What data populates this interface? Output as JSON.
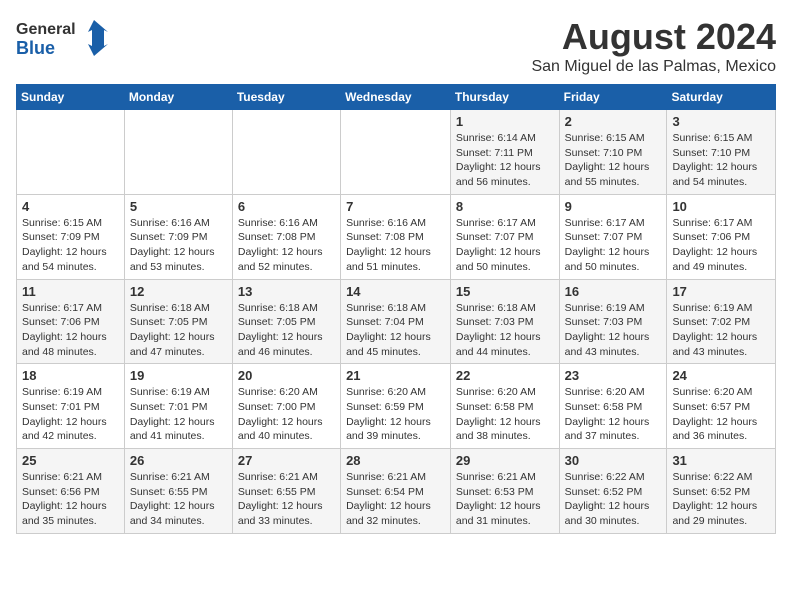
{
  "header": {
    "logo_general": "General",
    "logo_blue": "Blue",
    "month_year": "August 2024",
    "location": "San Miguel de las Palmas, Mexico"
  },
  "days_of_week": [
    "Sunday",
    "Monday",
    "Tuesday",
    "Wednesday",
    "Thursday",
    "Friday",
    "Saturday"
  ],
  "weeks": [
    [
      {
        "day": "",
        "info": ""
      },
      {
        "day": "",
        "info": ""
      },
      {
        "day": "",
        "info": ""
      },
      {
        "day": "",
        "info": ""
      },
      {
        "day": "1",
        "info": "Sunrise: 6:14 AM\nSunset: 7:11 PM\nDaylight: 12 hours\nand 56 minutes."
      },
      {
        "day": "2",
        "info": "Sunrise: 6:15 AM\nSunset: 7:10 PM\nDaylight: 12 hours\nand 55 minutes."
      },
      {
        "day": "3",
        "info": "Sunrise: 6:15 AM\nSunset: 7:10 PM\nDaylight: 12 hours\nand 54 minutes."
      }
    ],
    [
      {
        "day": "4",
        "info": "Sunrise: 6:15 AM\nSunset: 7:09 PM\nDaylight: 12 hours\nand 54 minutes."
      },
      {
        "day": "5",
        "info": "Sunrise: 6:16 AM\nSunset: 7:09 PM\nDaylight: 12 hours\nand 53 minutes."
      },
      {
        "day": "6",
        "info": "Sunrise: 6:16 AM\nSunset: 7:08 PM\nDaylight: 12 hours\nand 52 minutes."
      },
      {
        "day": "7",
        "info": "Sunrise: 6:16 AM\nSunset: 7:08 PM\nDaylight: 12 hours\nand 51 minutes."
      },
      {
        "day": "8",
        "info": "Sunrise: 6:17 AM\nSunset: 7:07 PM\nDaylight: 12 hours\nand 50 minutes."
      },
      {
        "day": "9",
        "info": "Sunrise: 6:17 AM\nSunset: 7:07 PM\nDaylight: 12 hours\nand 50 minutes."
      },
      {
        "day": "10",
        "info": "Sunrise: 6:17 AM\nSunset: 7:06 PM\nDaylight: 12 hours\nand 49 minutes."
      }
    ],
    [
      {
        "day": "11",
        "info": "Sunrise: 6:17 AM\nSunset: 7:06 PM\nDaylight: 12 hours\nand 48 minutes."
      },
      {
        "day": "12",
        "info": "Sunrise: 6:18 AM\nSunset: 7:05 PM\nDaylight: 12 hours\nand 47 minutes."
      },
      {
        "day": "13",
        "info": "Sunrise: 6:18 AM\nSunset: 7:05 PM\nDaylight: 12 hours\nand 46 minutes."
      },
      {
        "day": "14",
        "info": "Sunrise: 6:18 AM\nSunset: 7:04 PM\nDaylight: 12 hours\nand 45 minutes."
      },
      {
        "day": "15",
        "info": "Sunrise: 6:18 AM\nSunset: 7:03 PM\nDaylight: 12 hours\nand 44 minutes."
      },
      {
        "day": "16",
        "info": "Sunrise: 6:19 AM\nSunset: 7:03 PM\nDaylight: 12 hours\nand 43 minutes."
      },
      {
        "day": "17",
        "info": "Sunrise: 6:19 AM\nSunset: 7:02 PM\nDaylight: 12 hours\nand 43 minutes."
      }
    ],
    [
      {
        "day": "18",
        "info": "Sunrise: 6:19 AM\nSunset: 7:01 PM\nDaylight: 12 hours\nand 42 minutes."
      },
      {
        "day": "19",
        "info": "Sunrise: 6:19 AM\nSunset: 7:01 PM\nDaylight: 12 hours\nand 41 minutes."
      },
      {
        "day": "20",
        "info": "Sunrise: 6:20 AM\nSunset: 7:00 PM\nDaylight: 12 hours\nand 40 minutes."
      },
      {
        "day": "21",
        "info": "Sunrise: 6:20 AM\nSunset: 6:59 PM\nDaylight: 12 hours\nand 39 minutes."
      },
      {
        "day": "22",
        "info": "Sunrise: 6:20 AM\nSunset: 6:58 PM\nDaylight: 12 hours\nand 38 minutes."
      },
      {
        "day": "23",
        "info": "Sunrise: 6:20 AM\nSunset: 6:58 PM\nDaylight: 12 hours\nand 37 minutes."
      },
      {
        "day": "24",
        "info": "Sunrise: 6:20 AM\nSunset: 6:57 PM\nDaylight: 12 hours\nand 36 minutes."
      }
    ],
    [
      {
        "day": "25",
        "info": "Sunrise: 6:21 AM\nSunset: 6:56 PM\nDaylight: 12 hours\nand 35 minutes."
      },
      {
        "day": "26",
        "info": "Sunrise: 6:21 AM\nSunset: 6:55 PM\nDaylight: 12 hours\nand 34 minutes."
      },
      {
        "day": "27",
        "info": "Sunrise: 6:21 AM\nSunset: 6:55 PM\nDaylight: 12 hours\nand 33 minutes."
      },
      {
        "day": "28",
        "info": "Sunrise: 6:21 AM\nSunset: 6:54 PM\nDaylight: 12 hours\nand 32 minutes."
      },
      {
        "day": "29",
        "info": "Sunrise: 6:21 AM\nSunset: 6:53 PM\nDaylight: 12 hours\nand 31 minutes."
      },
      {
        "day": "30",
        "info": "Sunrise: 6:22 AM\nSunset: 6:52 PM\nDaylight: 12 hours\nand 30 minutes."
      },
      {
        "day": "31",
        "info": "Sunrise: 6:22 AM\nSunset: 6:52 PM\nDaylight: 12 hours\nand 29 minutes."
      }
    ]
  ]
}
